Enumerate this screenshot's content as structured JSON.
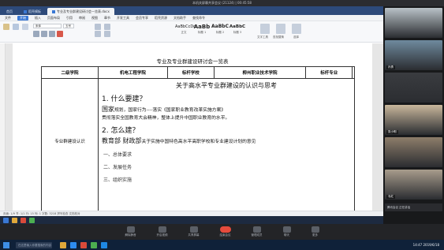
{
  "meeting_title": "本机关屏幕共享会议 (21124) | 00:45:58",
  "app_tabs": [
    {
      "label": "首页"
    },
    {
      "label": "稻壳模板"
    },
    {
      "label": "专业及专业群建设研讨会一览表.docx"
    }
  ],
  "menu": [
    "文件",
    "开始",
    "插入",
    "页面布局",
    "引用",
    "审阅",
    "视图",
    "章节",
    "开发工具",
    "会员专享",
    "稻壳资源",
    "文档助手",
    "查找命令"
  ],
  "ribbon": {
    "font_name": "宋体",
    "font_size": "五号",
    "styles": [
      {
        "sample": "AaBbCcDd",
        "label": "正文"
      },
      {
        "sample": "AaBb",
        "label": "标题 1"
      },
      {
        "sample": "AaBbC",
        "label": "标题 2"
      },
      {
        "sample": "AaBbC",
        "label": "标题 3"
      }
    ],
    "right_actions": [
      "文字工具",
      "查找替换",
      "选择"
    ]
  },
  "document": {
    "title": "专业及专业群建设研讨会一览表",
    "header_row": [
      "二级学院",
      "机电工程学院",
      "标杆学校",
      "柳州职业技术学院",
      "标杆专业",
      ""
    ],
    "left_label": "专业群建设认识",
    "content_title": "关于高水平专业群建设的认识与思考",
    "q1": "1. 什么要建？",
    "q1_line1_big": "国家",
    "q1_line1_rest": "规划，国家行为----落实《国家职业教育改革实施方案》",
    "q1_line2": "贯彻落实全国教育大会精神，整体上提升中国职业教育的水平。",
    "q2": "2. 怎么建？",
    "q2_line1_big": "教育部 财政部",
    "q2_line1_rest": "关于实施中国特色高水平高职学校和专业建设计划的意见",
    "items": [
      "一、总体要求",
      "二、发展任务",
      "三、组织实施"
    ]
  },
  "status_bar": "页面: 1/9  节: 1/1  行: 15  列: 1  字数: 3218  拼写检查  文档校对",
  "participants": [
    {
      "name": "",
      "bg": "#b9c2c8"
    },
    {
      "name": "孙勇",
      "bg": "#6f8a9e"
    },
    {
      "name": "",
      "bg": "#3a3c40"
    },
    {
      "name": "张小明",
      "bg": "#c9b79c"
    },
    {
      "name": "",
      "bg": "#8d7d6a"
    },
    {
      "name": "韦红",
      "bg": "#a89c8c"
    }
  ],
  "controls": [
    {
      "label": "解除静音"
    },
    {
      "label": "开启视频"
    },
    {
      "label": "共享屏幕"
    },
    {
      "label": "结束会议"
    },
    {
      "label": "管理成员"
    },
    {
      "label": "聊天"
    },
    {
      "label": "更多"
    }
  ],
  "side_footer": "腾讯会议 正在讲话",
  "taskbar_time": "14:47",
  "taskbar_date": "2019/6/18",
  "search_placeholder": "在这里输入你要搜索的内容",
  "colors": {
    "accent": "#3a78d4",
    "end_meeting": "#e64b3c"
  }
}
